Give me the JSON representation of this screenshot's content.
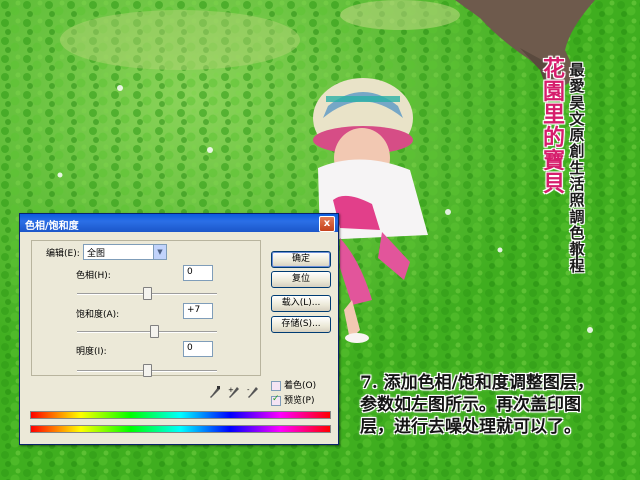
{
  "overlay": {
    "title_chars": [
      "花",
      "園",
      "里",
      "的",
      "寶",
      "貝"
    ],
    "subtitle_chars": [
      "最",
      "愛",
      "昊",
      "文",
      "原",
      "創",
      "生",
      "活",
      "照",
      "調",
      "色",
      "教",
      "程"
    ],
    "caption_lines": [
      "7. 添加色相/饱和度调整图层，",
      "参数如左图所示。再次盖印图",
      "层，进行去噪处理就可以了。"
    ]
  },
  "dialog": {
    "title": "色相/饱和度",
    "close_label": "x",
    "edit_label": "编辑(E):",
    "edit_value": "全图",
    "hue_label": "色相(H):",
    "hue_value": "0",
    "saturation_label": "饱和度(A):",
    "saturation_value": "+7",
    "lightness_label": "明度(I):",
    "lightness_value": "0",
    "buttons": {
      "ok": "确定",
      "reset": "复位",
      "load": "载入(L)...",
      "save": "存储(S)..."
    },
    "colorize_label": "着色(O)",
    "preview_label": "预览(P)",
    "colorize_checked": false,
    "preview_checked": true,
    "slider_levels": {
      "hue": 0.5,
      "saturation": 0.55,
      "lightness": 0.5
    }
  },
  "colors": {
    "title_pink": "#d61d6c",
    "titlebar_blue": "#0a5ce0",
    "grass_green": "#3fae1f"
  }
}
